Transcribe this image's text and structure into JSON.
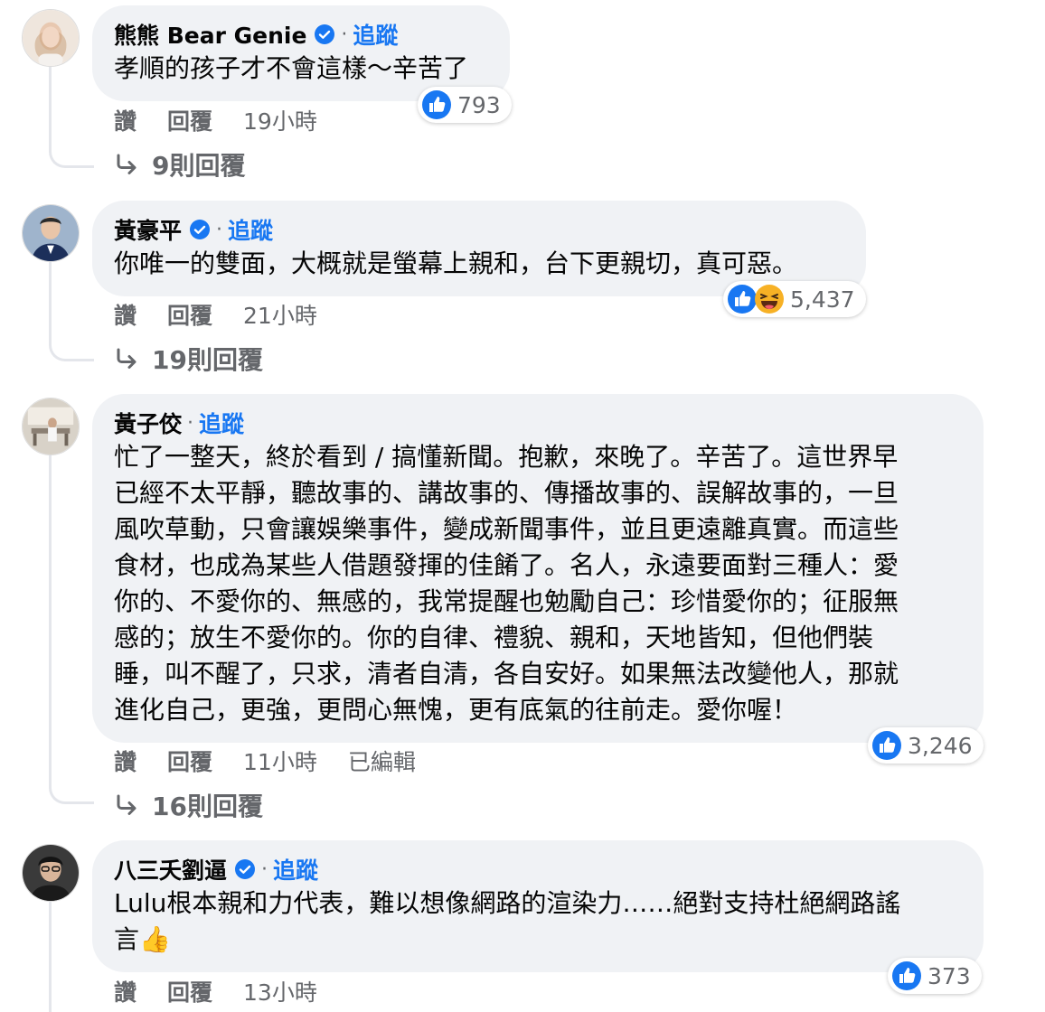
{
  "comments": [
    {
      "name": "熊熊 Bear Genie",
      "verified": true,
      "dot": "·",
      "follow": "追蹤",
      "text_lines": [
        "孝順的孩子才不會這樣～辛苦了"
      ],
      "reaction_count": "793",
      "reactions": [
        "like-icon"
      ],
      "actions": {
        "like": "讚",
        "reply": "回覆",
        "time": "19小時"
      },
      "replies": "9則回覆"
    },
    {
      "name": "黃豪平",
      "verified": true,
      "dot": "·",
      "follow": "追蹤",
      "text_lines": [
        "你唯一的雙面，大概就是螢幕上親和，台下更親切，真可惡。"
      ],
      "reaction_count": "5,437",
      "reactions": [
        "like-icon",
        "haha-icon"
      ],
      "actions": {
        "like": "讚",
        "reply": "回覆",
        "time": "21小時"
      },
      "replies": "19則回覆"
    },
    {
      "name": "黃子佼",
      "verified": false,
      "dot": "·",
      "follow": "追蹤",
      "text_lines": [
        "忙了一整天，終於看到 / 搞懂新聞。抱歉，來晚了。辛苦了。這世界早",
        "已經不太平靜，聽故事的、講故事的、傳播故事的、誤解故事的，一旦",
        "風吹草動，只會讓娛樂事件，變成新聞事件，並且更遠離真實。而這些",
        "食材，也成為某些人借題發揮的佳餚了。名人，永遠要面對三種人：愛",
        "你的、不愛你的、無感的，我常提醒也勉勵自己：珍惜愛你的；征服無",
        "感的；放生不愛你的。你的自律、禮貌、親和，天地皆知，但他們裝",
        "睡，叫不醒了，只求，清者自清，各自安好。如果無法改變他人，那就",
        "進化自己，更強，更問心無愧，更有底氣的往前走。愛你喔！"
      ],
      "reaction_count": "3,246",
      "reactions": [
        "like-icon"
      ],
      "actions": {
        "like": "讚",
        "reply": "回覆",
        "time": "11小時",
        "edited": "已編輯"
      },
      "replies": "16則回覆"
    },
    {
      "name": "八三夭劉逼",
      "verified": true,
      "dot": "·",
      "follow": "追蹤",
      "text_lines": [
        "Lulu根本親和力代表，難以想像網路的渲染力……絕對支持杜絕網路謠",
        "言👍"
      ],
      "reaction_count": "373",
      "reactions": [
        "like-icon"
      ],
      "actions": {
        "like": "讚",
        "reply": "回覆",
        "time": "13小時"
      }
    }
  ],
  "colors": {
    "bubble": "#f0f2f5",
    "link": "#1877f2",
    "meta": "#65676b",
    "like": "#1877f2",
    "haha": "#f7b125"
  }
}
